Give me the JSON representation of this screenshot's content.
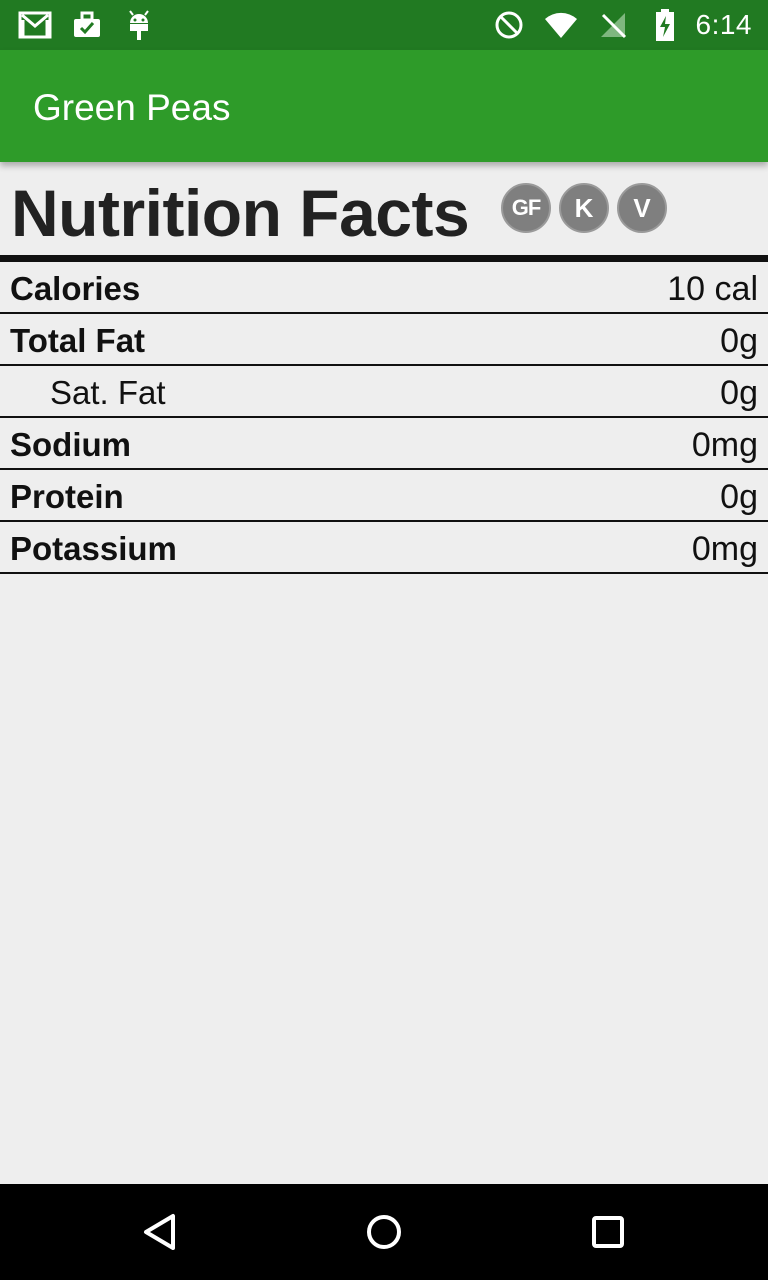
{
  "status_bar": {
    "time": "6:14",
    "left_icons": [
      "gmail-icon",
      "briefcase-check-icon",
      "android-icon"
    ],
    "right_icons": [
      "do-not-disturb-icon",
      "wifi-icon",
      "no-signal-icon",
      "battery-charging-icon"
    ]
  },
  "app_bar": {
    "title": "Green Peas",
    "color": "#2e9b29"
  },
  "nutrition": {
    "heading": "Nutrition Facts",
    "badges": [
      {
        "label": "GF",
        "icon": "gluten-free-icon"
      },
      {
        "label": "K",
        "icon": "kosher-icon"
      },
      {
        "label": "V",
        "icon": "vegan-icon"
      }
    ],
    "rows": [
      {
        "label": "Calories",
        "value": "10 cal",
        "sub": false
      },
      {
        "label": "Total Fat",
        "value": "0g",
        "sub": false
      },
      {
        "label": "Sat. Fat",
        "value": "0g",
        "sub": true
      },
      {
        "label": "Sodium",
        "value": "0mg",
        "sub": false
      },
      {
        "label": "Protein",
        "value": "0g",
        "sub": false
      },
      {
        "label": "Potassium",
        "value": "0mg",
        "sub": false
      }
    ]
  },
  "nav_bar": {
    "buttons": [
      "back-icon",
      "home-icon",
      "recents-icon"
    ]
  }
}
